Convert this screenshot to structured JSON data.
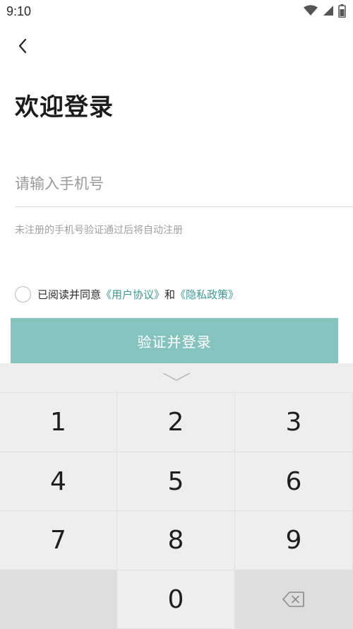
{
  "status_bar": {
    "time": "9:10",
    "icons": [
      "wifi-icon",
      "signal-icon",
      "battery-icon"
    ]
  },
  "nav": {
    "back_icon": "chevron-left-icon"
  },
  "title": "欢迎登录",
  "phone": {
    "placeholder": "请输入手机号",
    "value": ""
  },
  "hint": "未注册的手机号验证通过后将自动注册",
  "agreement": {
    "prefix": "已阅读并同意",
    "user_agreement": "《用户协议》",
    "and": "和",
    "privacy_policy": "《隐私政策》",
    "checked": false
  },
  "login_button": "验证并登录",
  "keyboard": {
    "collapse_icon": "chevron-down-icon",
    "keys": [
      "1",
      "2",
      "3",
      "4",
      "5",
      "6",
      "7",
      "8",
      "9",
      "",
      "0",
      "backspace"
    ]
  },
  "colors": {
    "accent": "#85c3bf",
    "link": "#3b9a96",
    "keyboard_bg": "#eeeeee"
  }
}
